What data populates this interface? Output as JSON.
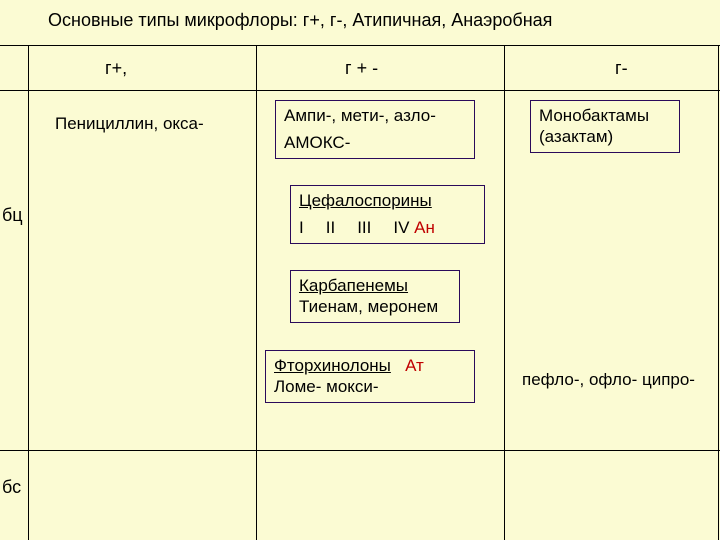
{
  "title": "Основные типы микрофлоры:   г+, г-, Атипичная, Анаэробная",
  "cols": {
    "c1": "г+,",
    "c2": "г + -",
    "c3": "г-"
  },
  "rows": {
    "r1": "бц",
    "r2": "бс"
  },
  "penicillin": "Пенициллин, окса-",
  "box_ampi": {
    "l1": "Ампи-, мети-, азло-",
    "l2": "АМОКС-"
  },
  "box_mono": {
    "l1": "Монобактамы",
    "l2": "(азактам)"
  },
  "box_ceph": {
    "title": "Цефалоспорины",
    "g1": "I",
    "g2": "II",
    "g3": "III",
    "g4": "IV",
    "an": "Ан"
  },
  "box_carb": {
    "l1": "Карбапенемы",
    "l2": "Тиенам, меронем"
  },
  "box_fq": {
    "l1a": "Фторхинолоны",
    "l1b": "Ат",
    "l2": "Ломе-  мокси-"
  },
  "peflo": "пефло-, офло- ципро-"
}
